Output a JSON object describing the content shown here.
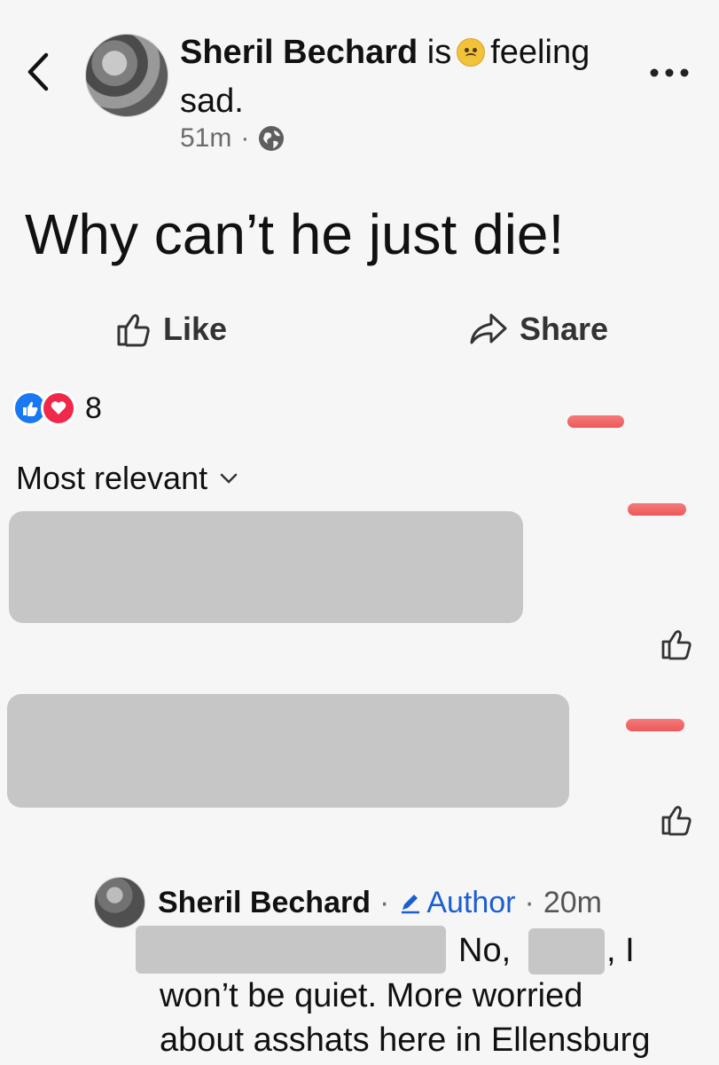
{
  "post": {
    "author": "Sheril Bechard",
    "is_word": "is",
    "feeling_text": "feeling",
    "feeling_value": "sad.",
    "time": "51m",
    "separator": "·",
    "body": "Why can’t he just die!",
    "feeling_icon": "sad-face-emoji",
    "privacy_icon": "globe-icon"
  },
  "actions": {
    "like_label": "Like",
    "share_label": "Share"
  },
  "reactions": {
    "count": "8",
    "types": [
      "like",
      "love"
    ]
  },
  "comments": {
    "sort_label": "Most relevant"
  },
  "reply": {
    "author": "Sheril Bechard",
    "separator": "·",
    "badge": "Author",
    "time": "20m",
    "text_start": "No,",
    "text_comma": ", I",
    "line2": "won’t be quiet. More worried",
    "line3": "about asshats here in Ellensburg"
  },
  "colors": {
    "background": "#f6f6f6",
    "like_blue": "#1a78f2",
    "love_red": "#f02849",
    "author_blue": "#1a5fd1",
    "redaction_gray": "#c6c6c6",
    "marker_red": "#ee5858"
  }
}
